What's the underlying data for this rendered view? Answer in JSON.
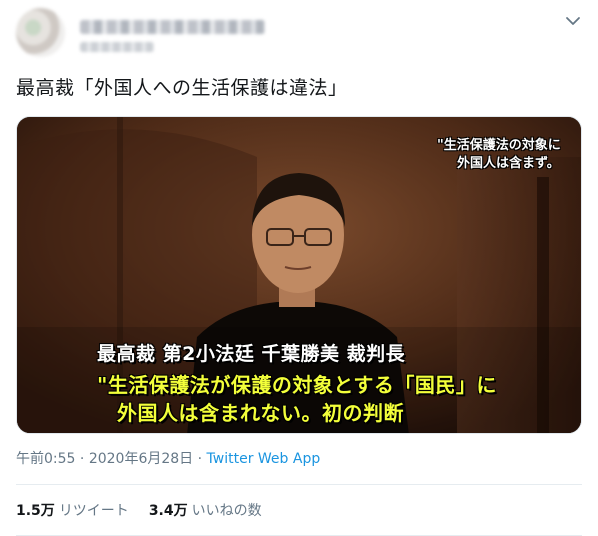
{
  "tweet": {
    "text": "最高裁「外国人への生活保護は違法」",
    "caption_top_line1": "\"生活保護法の対象に",
    "caption_top_line2": "外国人は含まず。",
    "caption_name": "最高裁 第2小法廷 千葉勝美 裁判長",
    "caption_quote_line1": "\"生活保護法が保護の対象とする「国民」に",
    "caption_quote_line2": "外国人は含まれない。初の判断",
    "time": "午前0:55",
    "separator": " · ",
    "date": "2020年6月28日",
    "app": "Twitter Web App",
    "retweets_count": "1.5万",
    "retweets_label": "リツイート",
    "likes_count": "3.4万",
    "likes_label": "いいねの数"
  },
  "icons": {
    "caret": "chevron-down-icon"
  }
}
